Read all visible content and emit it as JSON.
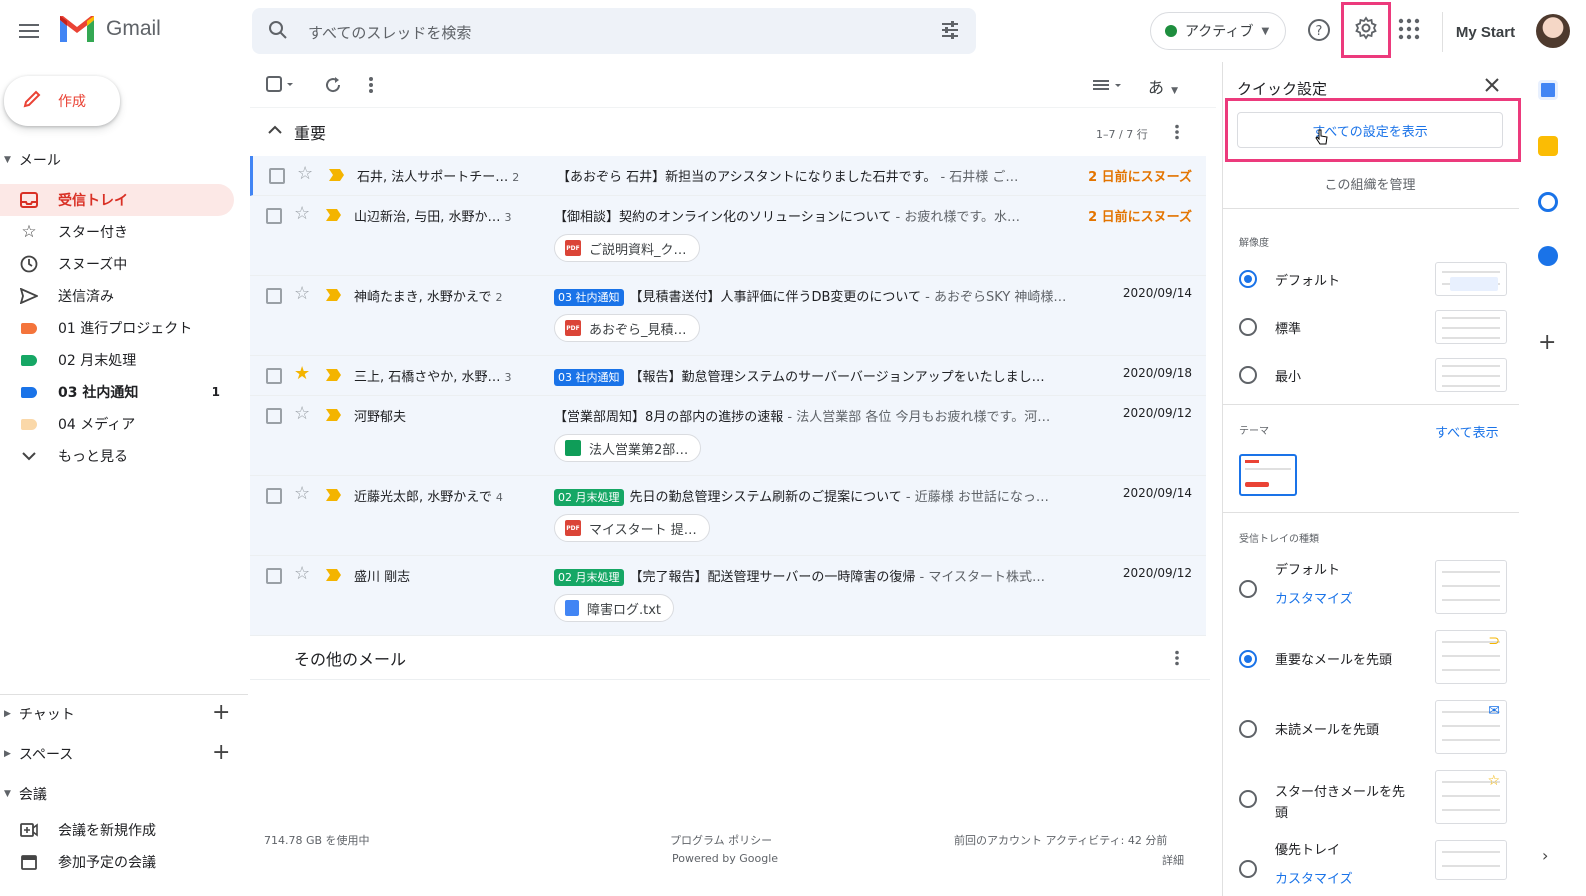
{
  "app": {
    "name": "Gmail"
  },
  "search": {
    "placeholder": "すべてのスレッドを検索"
  },
  "header": {
    "status": "アクティブ",
    "partner_brand": "My Start"
  },
  "compose": {
    "label": "作成"
  },
  "sidebar": {
    "mail_section": "メール",
    "items": [
      {
        "label": "受信トレイ",
        "icon": "inbox-icon",
        "selected": true
      },
      {
        "label": "スター付き",
        "icon": "star-icon"
      },
      {
        "label": "スヌーズ中",
        "icon": "clock-icon"
      },
      {
        "label": "送信済み",
        "icon": "send-icon"
      },
      {
        "label": "01 進行プロジェクト",
        "color": "#f4743b"
      },
      {
        "label": "02 月末処理",
        "color": "#16a765"
      },
      {
        "label": "03 社内通知",
        "color": "#1a73e8",
        "count": "1",
        "bold": true
      },
      {
        "label": "04 メディア",
        "color": "#fad8a9"
      },
      {
        "label": "もっと見る",
        "icon": "chevron-down-icon"
      }
    ],
    "chat": "チャット",
    "spaces": "スペース",
    "meet": "会議",
    "meet_items": [
      "会議を新規作成",
      "参加予定の会議"
    ]
  },
  "toolbar": {
    "density_label": "あ"
  },
  "important_section": {
    "title": "重要",
    "range": "1–7 / 7 行"
  },
  "emails": [
    {
      "sender": "石井, 法人サポートチー…",
      "count": "2",
      "tag": "",
      "subject": "【あおぞら 石井】新担当のアシスタントになりました石井です。",
      "snippet": " - 石井様 ご…",
      "date": "2 日前にスヌーズ",
      "snoozed": true,
      "starred": false,
      "attachment": ""
    },
    {
      "sender": "山辺新治, 与田, 水野か…",
      "count": "3",
      "tag": "",
      "subject": "【御相談】契約のオンライン化のソリューションについて",
      "snippet": " - お疲れ様です。水…",
      "date": "2 日前にスヌーズ",
      "snoozed": true,
      "starred": false,
      "attachment": "ご説明資料_ク…"
    },
    {
      "sender": "神崎たまき, 水野かえで",
      "count": "2",
      "tag": "03 社内通知",
      "tag_color": "#1a73e8",
      "subject": "【見積書送付】人事評価に伴うDB変更のについて",
      "snippet": " - あおぞらSKY 神崎様…",
      "date": "2020/09/14",
      "snoozed": false,
      "starred": false,
      "attachment": "あおぞら_見積…"
    },
    {
      "sender": "三上, 石橋さやか, 水野…",
      "count": "3",
      "tag": "03 社内通知",
      "tag_color": "#1a73e8",
      "subject": "【報告】勤怠管理システムのサーバーバージョンアップをいたしまし…",
      "snippet": "",
      "date": "2020/09/18",
      "snoozed": false,
      "starred": true,
      "attachment": ""
    },
    {
      "sender": "河野郁夫",
      "count": "",
      "tag": "",
      "subject": "【営業部周知】8月の部内の進捗の速報",
      "snippet": " - 法人営業部 各位 今月もお疲れ様です。河…",
      "date": "2020/09/12",
      "snoozed": false,
      "starred": false,
      "attachment": "法人営業第2部…"
    },
    {
      "sender": "近藤光太郎, 水野かえで",
      "count": "4",
      "tag": "02 月末処理",
      "tag_color": "#16a765",
      "subject": "先日の勤怠管理システム刷新のご提案について",
      "snippet": " - 近藤様 お世話になっ…",
      "date": "2020/09/14",
      "snoozed": false,
      "starred": false,
      "attachment": "マイスタート 提…"
    },
    {
      "sender": "盛川 剛志",
      "count": "",
      "tag": "02 月末処理",
      "tag_color": "#16a765",
      "subject": "【完了報告】配送管理サーバーの一時障害の復帰",
      "snippet": " - マイスタート株式…",
      "date": "2020/09/12",
      "snoozed": false,
      "starred": false,
      "attachment": "障害ログ.txt"
    }
  ],
  "other_section": {
    "title": "その他のメール"
  },
  "footer": {
    "storage": "714.78 GB を使用中",
    "policy": "プログラム ポリシー",
    "powered": "Powered by Google",
    "activity": "前回のアカウント アクティビティ: 42 分前",
    "details": "詳細"
  },
  "quick_settings": {
    "title": "クイック設定",
    "all_settings": "すべての設定を表示",
    "manage_org": "この組織を管理",
    "density_caption": "解像度",
    "density_options": [
      "デフォルト",
      "標準",
      "最小"
    ],
    "density_selected": 0,
    "theme_caption": "テーマ",
    "theme_show_all": "すべて表示",
    "inbox_type_caption": "受信トレイの種類",
    "inbox_options": [
      "デフォルト",
      "重要なメールを先頭",
      "未読メールを先頭",
      "スター付きメールを先頭",
      "優先トレイ"
    ],
    "inbox_selected": 1,
    "customize": "カスタマイズ"
  }
}
